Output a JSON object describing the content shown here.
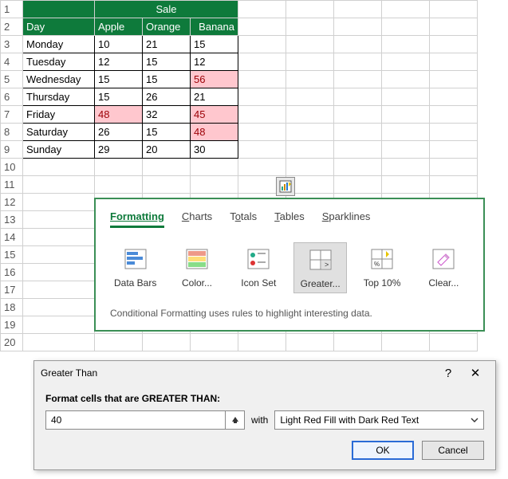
{
  "table": {
    "merged_header": "Sale",
    "headers": {
      "day": "Day",
      "apple": "Apple",
      "orange": "Orange",
      "banana": "Banana"
    },
    "row_numbers": [
      "1",
      "2",
      "3",
      "4",
      "5",
      "6",
      "7",
      "8",
      "9",
      "10",
      "11",
      "12",
      "13",
      "14",
      "15",
      "16",
      "17",
      "18",
      "19",
      "20"
    ],
    "rows": [
      {
        "day": "Monday",
        "apple": "10",
        "orange": "21",
        "banana": "15"
      },
      {
        "day": "Tuesday",
        "apple": "12",
        "orange": "15",
        "banana": "12"
      },
      {
        "day": "Wednesday",
        "apple": "15",
        "orange": "15",
        "banana": "56",
        "hl": [
          "banana"
        ]
      },
      {
        "day": "Thursday",
        "apple": "15",
        "orange": "26",
        "banana": "21"
      },
      {
        "day": "Friday",
        "apple": "48",
        "orange": "32",
        "banana": "45",
        "hl": [
          "apple",
          "banana"
        ]
      },
      {
        "day": "Saturday",
        "apple": "26",
        "orange": "15",
        "banana": "48",
        "hl": [
          "banana"
        ]
      },
      {
        "day": "Sunday",
        "apple": "29",
        "orange": "20",
        "banana": "30"
      }
    ]
  },
  "quick_analysis": {
    "tabs": {
      "formatting": "Formatting",
      "charts": "Charts",
      "totals": "Totals",
      "tables": "Tables",
      "sparklines": "Sparklines"
    },
    "items": {
      "databars": "Data Bars",
      "color": "Color...",
      "iconset": "Icon Set",
      "greater": "Greater...",
      "top10": "Top 10%",
      "clear": "Clear..."
    },
    "footer": "Conditional Formatting uses rules to highlight interesting data."
  },
  "dialog": {
    "title": "Greater Than",
    "label": "Format cells that are GREATER THAN:",
    "value": "40",
    "with": "with",
    "format_option": "Light Red Fill with Dark Red Text",
    "ok": "OK",
    "cancel": "Cancel",
    "help": "?",
    "close": "✕"
  },
  "chart_data": {
    "type": "table",
    "title": "Sale",
    "categories": [
      "Monday",
      "Tuesday",
      "Wednesday",
      "Thursday",
      "Friday",
      "Saturday",
      "Sunday"
    ],
    "series": [
      {
        "name": "Apple",
        "values": [
          10,
          12,
          15,
          15,
          48,
          26,
          29
        ]
      },
      {
        "name": "Orange",
        "values": [
          21,
          15,
          15,
          26,
          32,
          15,
          20
        ]
      },
      {
        "name": "Banana",
        "values": [
          15,
          12,
          56,
          21,
          45,
          48,
          30
        ]
      }
    ]
  }
}
